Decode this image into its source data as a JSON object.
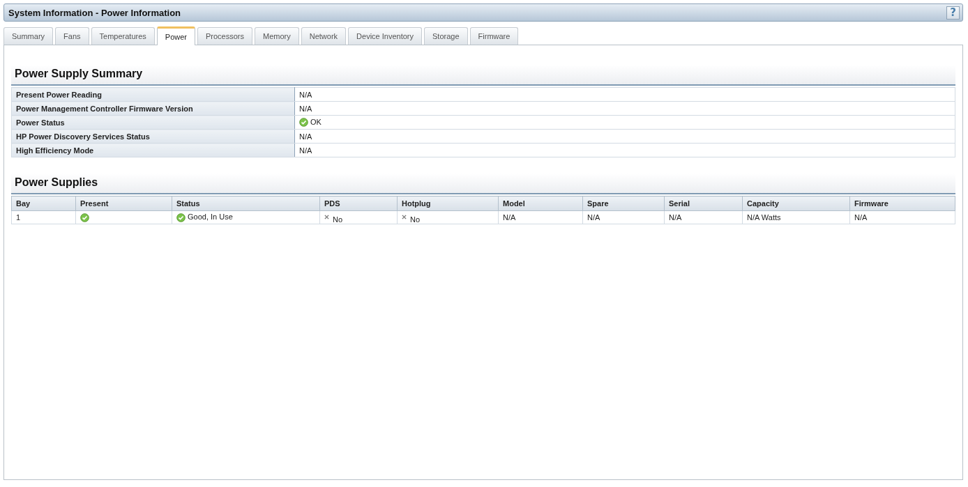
{
  "window": {
    "title": "System Information - Power Information",
    "help": "?"
  },
  "tabs": [
    {
      "label": "Summary",
      "selected": false
    },
    {
      "label": "Fans",
      "selected": false
    },
    {
      "label": "Temperatures",
      "selected": false
    },
    {
      "label": "Power",
      "selected": true
    },
    {
      "label": "Processors",
      "selected": false
    },
    {
      "label": "Memory",
      "selected": false
    },
    {
      "label": "Network",
      "selected": false
    },
    {
      "label": "Device Inventory",
      "selected": false
    },
    {
      "label": "Storage",
      "selected": false
    },
    {
      "label": "Firmware",
      "selected": false
    }
  ],
  "summary": {
    "title": "Power Supply Summary",
    "rows": [
      {
        "kind": "plain",
        "label": "Present Power Reading",
        "value": "N/A"
      },
      {
        "kind": "plain",
        "label": "Power Management Controller Firmware Version",
        "value": "N/A"
      },
      {
        "kind": "ok",
        "label": "Power Status",
        "value": "OK"
      },
      {
        "kind": "plain",
        "label": "HP Power Discovery Services Status",
        "value": "N/A"
      },
      {
        "kind": "plain",
        "label": "High Efficiency Mode",
        "value": "N/A"
      }
    ]
  },
  "supplies": {
    "title": "Power Supplies",
    "columns": [
      "Bay",
      "Present",
      "Status",
      "PDS",
      "Hotplug",
      "Model",
      "Spare",
      "Serial",
      "Capacity",
      "Firmware"
    ],
    "rows": [
      [
        {
          "kind": "plain",
          "text": "1"
        },
        {
          "kind": "ok"
        },
        {
          "kind": "ok",
          "text": "Good, In Use"
        },
        {
          "kind": "cross",
          "text": "No"
        },
        {
          "kind": "cross",
          "text": "No"
        },
        {
          "kind": "plain",
          "text": "N/A"
        },
        {
          "kind": "plain",
          "text": "N/A"
        },
        {
          "kind": "plain",
          "text": "N/A"
        },
        {
          "kind": "plain",
          "text": "N/A  Watts"
        },
        {
          "kind": "plain",
          "text": "N/A"
        }
      ]
    ]
  }
}
